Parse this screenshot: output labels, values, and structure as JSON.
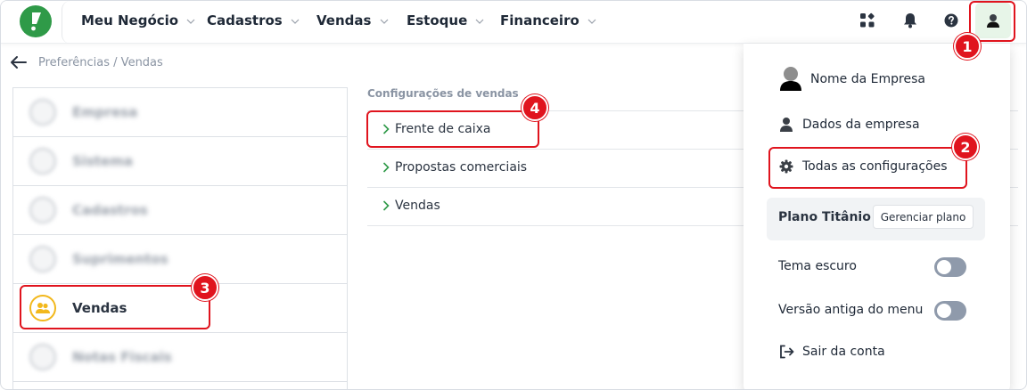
{
  "nav": {
    "items": [
      "Meu Negócio",
      "Cadastros",
      "Vendas",
      "Estoque",
      "Financeiro"
    ]
  },
  "topbar": {
    "icons": [
      "apps-icon",
      "bell-icon",
      "help-icon",
      "user-avatar-icon"
    ]
  },
  "breadcrumb": "Preferências / Vendas",
  "sidebar": {
    "items": [
      {
        "label": "Empresa"
      },
      {
        "label": "Sistema"
      },
      {
        "label": "Cadastros"
      },
      {
        "label": "Suprimentos"
      },
      {
        "label": "Vendas"
      },
      {
        "label": "Notas Fiscais"
      }
    ],
    "active_label": "Vendas"
  },
  "config": {
    "title": "Configurações de vendas",
    "items": [
      "Frente de caixa",
      "Propostas comerciais",
      "Vendas"
    ]
  },
  "user_menu": {
    "company_name": "Nome da Empresa",
    "company_data": "Dados da empresa",
    "all_settings": "Todas as configurações",
    "plan_name": "Plano Titânio",
    "manage_plan": "Gerenciar plano",
    "dark_theme": "Tema escuro",
    "old_menu": "Versão antiga do menu",
    "logout": "Sair da conta",
    "dark_theme_on": false,
    "old_menu_on": false
  },
  "annotations": [
    "1",
    "2",
    "3",
    "4"
  ],
  "colors": {
    "brand_green": "#2f9a48",
    "highlight_red": "#e0141e",
    "active_icon_yellow": "#f2b81c"
  }
}
